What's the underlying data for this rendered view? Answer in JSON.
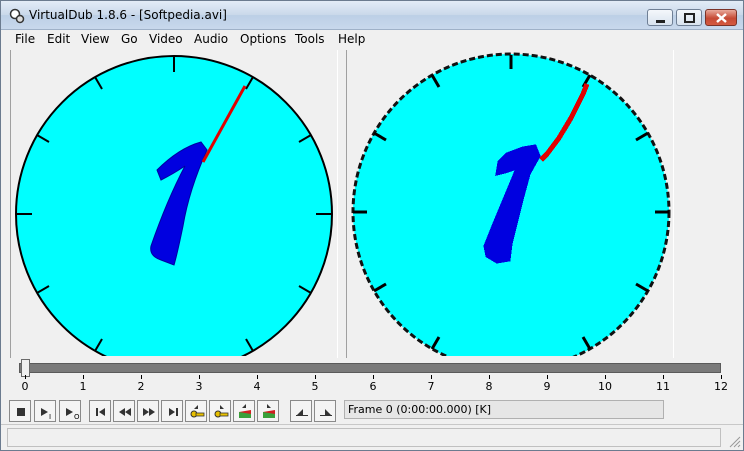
{
  "window": {
    "title": "VirtualDub 1.8.6 - [Softpedia.avi]"
  },
  "menu": [
    "File",
    "Edit",
    "View",
    "Go",
    "Video",
    "Audio",
    "Options",
    "Tools",
    "Help"
  ],
  "timeline": {
    "ticks": [
      "0",
      "1",
      "2",
      "3",
      "4",
      "5",
      "6",
      "7",
      "8",
      "9",
      "10",
      "11",
      "12"
    ],
    "position": 0,
    "max": 12
  },
  "status": {
    "frame": "Frame 0 (0:00:00.000) [K]"
  },
  "colors": {
    "clock_face": "#00ffff",
    "digit": "#0000e0",
    "hand": "#e00000"
  },
  "icons": {
    "toolbar": [
      "stop-icon",
      "play-input-icon",
      "play-output-icon",
      "go-start-icon",
      "step-back-icon",
      "step-forward-icon",
      "go-end-icon",
      "key-prev-icon",
      "key-next-icon",
      "scene-prev-icon",
      "scene-next-icon",
      "mark-in-icon",
      "mark-out-icon"
    ]
  }
}
